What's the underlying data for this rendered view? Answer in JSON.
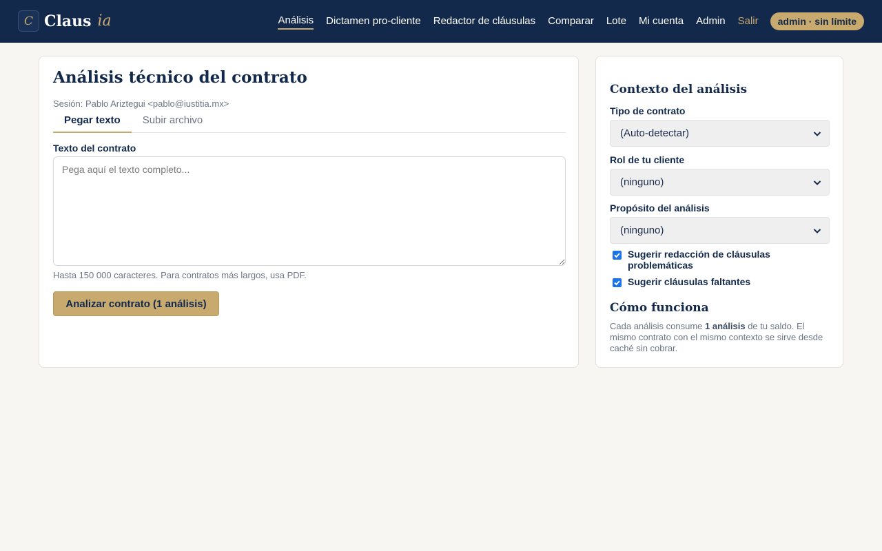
{
  "brand": {
    "mark": "C",
    "name": "Claus",
    "accent": "ia"
  },
  "nav": {
    "items": [
      "Análisis",
      "Dictamen pro-cliente",
      "Redactor de cláusulas",
      "Comparar",
      "Lote",
      "Mi cuenta",
      "Admin"
    ],
    "logout": "Salir",
    "badge": "admin · sin límite"
  },
  "main": {
    "title": "Análisis técnico del contrato",
    "session": "Sesión: Pablo Ariztegui <pablo@iustitia.mx>",
    "tabs": [
      "Pegar texto",
      "Subir archivo"
    ],
    "text_label": "Texto del contrato",
    "textarea_placeholder": "Pega aquí el texto completo...",
    "textarea_value": "",
    "hint": "Hasta 150 000 caracteres. Para contratos más largos, usa PDF.",
    "submit": "Analizar contrato (1 análisis)"
  },
  "sidebar": {
    "context_title": "Contexto del análisis",
    "fields": [
      {
        "label": "Tipo de contrato",
        "value": "(Auto-detectar)"
      },
      {
        "label": "Rol de tu cliente",
        "value": "(ninguno)"
      },
      {
        "label": "Propósito del análisis",
        "value": "(ninguno)"
      }
    ],
    "checks": [
      {
        "label": "Sugerir redacción de cláusulas problemáticas",
        "checked": true
      },
      {
        "label": "Sugerir cláusulas faltantes",
        "checked": true
      }
    ],
    "how_title": "Cómo funciona",
    "how_text_1": "Cada análisis consume ",
    "how_text_bold": "1 análisis",
    "how_text_2": " de tu saldo. El mismo contrato con el mismo contexto se sirve desde caché sin cobrar."
  },
  "colors": {
    "navy": "#13294b",
    "gold": "#c8a96e",
    "background": "#f8f6f2",
    "checkbox": "#1a73e8"
  }
}
